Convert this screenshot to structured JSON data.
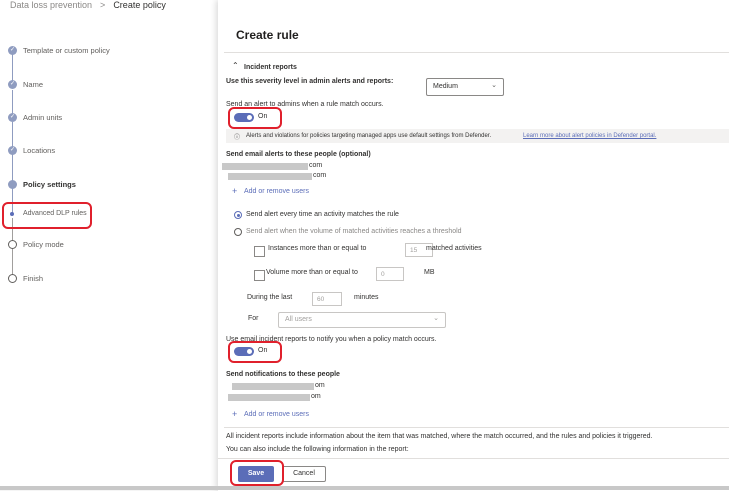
{
  "breadcrumb": {
    "parent": "Data loss prevention",
    "separator": ">",
    "current": "Create policy"
  },
  "steps": [
    {
      "label": "Template or custom policy",
      "state": "done"
    },
    {
      "label": "Name",
      "state": "done"
    },
    {
      "label": "Admin units",
      "state": "done"
    },
    {
      "label": "Locations",
      "state": "done"
    },
    {
      "label": "Policy settings",
      "state": "current"
    },
    {
      "label": "Advanced DLP rules",
      "state": "sub"
    },
    {
      "label": "Policy mode",
      "state": "pending"
    },
    {
      "label": "Finish",
      "state": "pending"
    }
  ],
  "panel": {
    "title": "Create rule",
    "incident_header": "Incident reports",
    "severity_label": "Use this severity level in admin alerts and reports:",
    "severity_value": "Medium",
    "send_alert_label": "Send an alert to admins when a rule match occurs.",
    "toggle_on": "On",
    "info_text": "Alerts and violations for policies targeting managed apps use default settings from Defender.",
    "info_link": "Learn more about alert policies in Defender portal.",
    "email_alerts_label": "Send email alerts to these people (optional)",
    "email1_suffix": "com",
    "email2_suffix": "com",
    "add_remove_users": "Add or remove users",
    "radio_every": "Send alert every time an activity matches the rule",
    "radio_threshold": "Send alert when the volume of matched activities reaches a threshold",
    "instances_label": "Instances more than or equal to",
    "instances_value": "15",
    "instances_unit": "matched activities",
    "volume_label": "Volume more than or equal to",
    "volume_value": "0",
    "volume_unit": "MB",
    "during_label": "During the last",
    "during_value": "60",
    "during_unit": "minutes",
    "for_label": "For",
    "for_value": "All users",
    "incident_email_label": "Use email incident reports to notify you when a policy match occurs.",
    "notify_label": "Send notifications to these people",
    "notify1_suffix": "om",
    "notify2_suffix": "om",
    "add_remove_users2": "Add or remove users",
    "all_reports_text": "All incident reports include information about the item that was matched, where the match occurred, and the rules and policies it triggered.",
    "also_include_text": "You can also include the following information in the report:",
    "save": "Save",
    "cancel": "Cancel"
  },
  "colors": {
    "accent": "#5b6db8",
    "highlight": "#e0202c"
  }
}
